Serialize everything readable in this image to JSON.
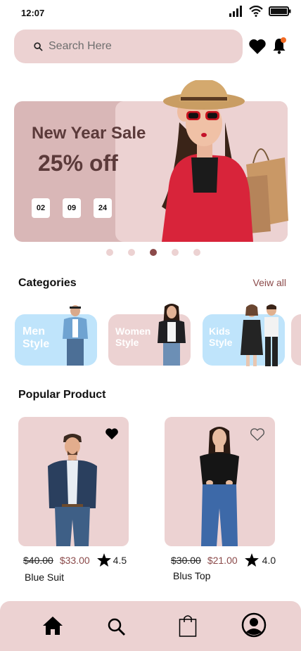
{
  "status_bar": {
    "time": "12:07",
    "icons": [
      "signal-icon",
      "wifi-icon",
      "battery-icon"
    ]
  },
  "search": {
    "placeholder": "Search Here",
    "value": ""
  },
  "header_icons": {
    "wishlist": "heart-icon",
    "notifications": "bell-icon"
  },
  "banner": {
    "title": "New Year Sale",
    "discount": "25% off",
    "countdown": [
      "02",
      "09",
      "24"
    ],
    "carousel_pages": 5,
    "active_page": 3
  },
  "categories": {
    "title": "Categories",
    "view_all": "Veiw all",
    "items": [
      {
        "line1": "Men",
        "line2": "Style"
      },
      {
        "line1": "Women",
        "line2": "Style"
      },
      {
        "line1": "Kids",
        "line2": "Style"
      }
    ]
  },
  "popular": {
    "title": "Popular Product",
    "products": [
      {
        "name": "Blue Suit",
        "old_price": "$40.00",
        "price": "$33.00",
        "rating": "4.5",
        "favorited": true
      },
      {
        "name": "Blus Top",
        "old_price": "$30.00",
        "price": "$21.00",
        "rating": "4.0",
        "favorited": false
      }
    ]
  },
  "colors": {
    "accent": "#8b4a4a",
    "card": "#ecd2d2",
    "banner_left": "#d9b7b7",
    "category_bg": "#bfe4fb"
  },
  "bottom_nav": [
    "home-icon",
    "search-icon",
    "bag-icon",
    "profile-icon"
  ]
}
